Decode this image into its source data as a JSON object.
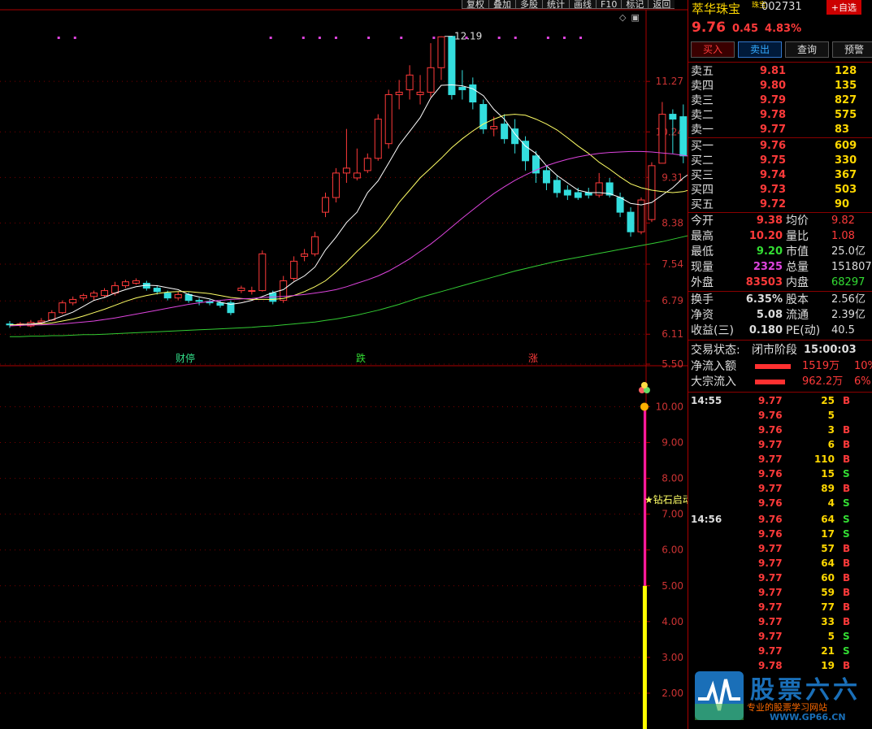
{
  "toolbar": [
    "复权",
    "叠加",
    "多股",
    "统计",
    "画线",
    "F10",
    "标记",
    "返回"
  ],
  "chart": {
    "upper_ticks": [
      "11.27",
      "10.24",
      "9.31",
      "8.38",
      "7.54",
      "6.79",
      "6.11",
      "5.50"
    ],
    "lower_ticks": [
      "10.00",
      "9.00",
      "8.00",
      "7.00",
      "6.00",
      "5.00",
      "4.00",
      "3.00",
      "2.00"
    ],
    "max_label": "12.19",
    "events": [
      "财停",
      "跌",
      "涨"
    ],
    "signal_label": "★钻石启动",
    "colors": {
      "up": "#ff3a3a",
      "down": "#33dddd",
      "ma5": "#ffffff",
      "ma10": "#ffff66",
      "ma20": "#dd44dd",
      "ma60": "#33cc33",
      "bar_top": "#ff1aa0",
      "bar_bottom": "#ffff00"
    }
  },
  "chart_data": {
    "type": "candlestick",
    "ylim": [
      5.5,
      12.6
    ],
    "candles": [
      [
        6.32,
        6.3,
        6.38,
        6.24
      ],
      [
        6.3,
        6.32,
        6.36,
        6.25
      ],
      [
        6.28,
        6.35,
        6.4,
        6.25
      ],
      [
        6.35,
        6.38,
        6.44,
        6.3
      ],
      [
        6.4,
        6.55,
        6.6,
        6.38
      ],
      [
        6.55,
        6.75,
        6.8,
        6.52
      ],
      [
        6.75,
        6.82,
        6.88,
        6.7
      ],
      [
        6.85,
        6.9,
        6.94,
        6.8
      ],
      [
        6.88,
        6.95,
        7.0,
        6.8
      ],
      [
        6.9,
        7.0,
        7.05,
        6.86
      ],
      [
        6.95,
        7.1,
        7.18,
        6.9
      ],
      [
        7.1,
        7.18,
        7.22,
        7.05
      ],
      [
        7.15,
        7.2,
        7.25,
        7.12
      ],
      [
        7.15,
        7.05,
        7.2,
        7.0
      ],
      [
        7.05,
        6.98,
        7.1,
        6.92
      ],
      [
        6.95,
        6.85,
        7.0,
        6.8
      ],
      [
        6.85,
        6.92,
        6.98,
        6.8
      ],
      [
        6.92,
        6.8,
        6.96,
        6.75
      ],
      [
        6.8,
        6.78,
        6.85,
        6.7
      ],
      [
        6.78,
        6.75,
        6.82,
        6.7
      ],
      [
        6.75,
        6.7,
        6.8,
        6.65
      ],
      [
        6.75,
        6.55,
        6.8,
        6.5
      ],
      [
        7.0,
        7.05,
        7.1,
        6.95
      ],
      [
        7.0,
        7.0,
        7.08,
        6.92
      ],
      [
        7.0,
        7.75,
        7.82,
        6.98
      ],
      [
        6.95,
        6.78,
        7.0,
        6.72
      ],
      [
        6.8,
        7.2,
        7.3,
        6.75
      ],
      [
        7.25,
        7.6,
        7.7,
        7.2
      ],
      [
        7.7,
        7.75,
        7.85,
        7.6
      ],
      [
        7.75,
        8.1,
        8.2,
        7.7
      ],
      [
        8.6,
        8.9,
        9.0,
        8.5
      ],
      [
        8.9,
        9.4,
        9.5,
        8.8
      ],
      [
        9.4,
        9.5,
        10.3,
        9.2
      ],
      [
        9.3,
        9.4,
        9.9,
        9.25
      ],
      [
        9.45,
        9.7,
        9.8,
        9.4
      ],
      [
        9.7,
        10.5,
        10.6,
        9.65
      ],
      [
        10.0,
        11.0,
        11.1,
        9.9
      ],
      [
        11.0,
        11.05,
        11.3,
        10.7
      ],
      [
        11.1,
        11.4,
        11.6,
        10.9
      ],
      [
        11.0,
        11.05,
        11.4,
        10.8
      ],
      [
        11.05,
        11.55,
        12.05,
        10.95
      ],
      [
        11.55,
        12.18,
        12.19,
        11.3
      ],
      [
        12.19,
        11.0,
        12.19,
        10.9
      ],
      [
        11.15,
        11.1,
        11.5,
        10.9
      ],
      [
        11.2,
        10.85,
        11.35,
        10.7
      ],
      [
        10.8,
        10.3,
        10.9,
        10.2
      ],
      [
        10.3,
        10.35,
        10.55,
        10.15
      ],
      [
        10.4,
        10.1,
        10.6,
        10.0
      ],
      [
        10.3,
        10.0,
        10.5,
        9.8
      ],
      [
        10.05,
        9.65,
        10.15,
        9.45
      ],
      [
        9.75,
        9.4,
        9.85,
        9.2
      ],
      [
        9.45,
        9.2,
        9.55,
        9.05
      ],
      [
        9.25,
        9.0,
        9.35,
        8.9
      ],
      [
        9.05,
        8.95,
        9.15,
        8.85
      ],
      [
        9.0,
        8.9,
        9.1,
        8.85
      ],
      [
        9.0,
        8.95,
        9.1,
        8.88
      ],
      [
        8.95,
        9.2,
        9.4,
        8.9
      ],
      [
        9.2,
        8.95,
        9.3,
        8.9
      ],
      [
        8.9,
        8.6,
        9.0,
        8.5
      ],
      [
        8.6,
        8.2,
        8.7,
        8.1
      ],
      [
        8.2,
        8.85,
        8.9,
        8.15
      ],
      [
        8.45,
        9.55,
        9.62,
        8.4
      ],
      [
        9.6,
        10.6,
        10.85,
        9.8
      ],
      [
        10.6,
        10.5,
        10.7,
        9.8
      ],
      [
        10.55,
        9.75,
        10.8,
        9.6
      ],
      [
        9.95,
        9.1,
        10.1,
        9.05
      ],
      [
        9.3,
        9.6,
        9.75,
        8.95
      ],
      [
        9.6,
        9.65,
        9.75,
        9.55
      ],
      [
        9.65,
        9.5,
        9.7,
        9.4
      ],
      [
        9.5,
        9.35,
        9.6,
        9.2
      ],
      [
        9.4,
        9.35,
        9.55,
        9.28
      ],
      [
        9.3,
        9.76,
        10.2,
        9.2
      ]
    ],
    "ma_series": [
      {
        "name": "MA5",
        "values": [
          6.3,
          6.31,
          6.32,
          6.34,
          6.4,
          6.48,
          6.56,
          6.68,
          6.8,
          6.86,
          6.95,
          7.02,
          7.08,
          7.11,
          7.1,
          7.06,
          7.02,
          6.92,
          6.87,
          6.83,
          6.76,
          6.72,
          6.75,
          6.8,
          6.88,
          6.96,
          7.02,
          7.18,
          7.3,
          7.48,
          7.83,
          8.09,
          8.39,
          8.6,
          9.0,
          9.24,
          9.6,
          9.97,
          10.25,
          10.53,
          10.93,
          11.19,
          11.2,
          11.18,
          11.12,
          10.98,
          10.7,
          10.5,
          10.2,
          9.95,
          9.8,
          9.55,
          9.35,
          9.2,
          9.05,
          9.0,
          9.0,
          8.98,
          8.9,
          8.78,
          8.75,
          8.8,
          8.95,
          9.1,
          9.3,
          9.45,
          9.5,
          9.55,
          9.55,
          9.5,
          9.48,
          9.52
        ]
      },
      {
        "name": "MA10",
        "values": [
          6.3,
          6.3,
          6.31,
          6.32,
          6.34,
          6.38,
          6.42,
          6.48,
          6.55,
          6.62,
          6.7,
          6.78,
          6.85,
          6.9,
          6.94,
          6.97,
          6.98,
          6.98,
          6.96,
          6.94,
          6.9,
          6.86,
          6.84,
          6.82,
          6.82,
          6.82,
          6.84,
          6.9,
          6.98,
          7.08,
          7.2,
          7.38,
          7.58,
          7.8,
          8.0,
          8.22,
          8.5,
          8.8,
          9.05,
          9.3,
          9.5,
          9.7,
          9.92,
          10.1,
          10.26,
          10.4,
          10.5,
          10.58,
          10.6,
          10.58,
          10.5,
          10.4,
          10.28,
          10.12,
          9.95,
          9.8,
          9.62,
          9.48,
          9.32,
          9.18,
          9.1,
          9.05,
          9.02,
          9.0,
          9.02,
          9.08,
          9.15,
          9.2,
          9.25,
          9.3,
          9.36,
          9.42
        ]
      },
      {
        "name": "MA20",
        "values": [
          6.28,
          6.29,
          6.3,
          6.3,
          6.31,
          6.32,
          6.34,
          6.36,
          6.38,
          6.41,
          6.44,
          6.48,
          6.52,
          6.56,
          6.6,
          6.64,
          6.68,
          6.72,
          6.75,
          6.78,
          6.8,
          6.82,
          6.83,
          6.84,
          6.86,
          6.87,
          6.88,
          6.9,
          6.92,
          6.95,
          6.98,
          7.02,
          7.08,
          7.15,
          7.22,
          7.3,
          7.4,
          7.52,
          7.65,
          7.8,
          7.95,
          8.12,
          8.3,
          8.48,
          8.65,
          8.82,
          8.98,
          9.12,
          9.25,
          9.36,
          9.46,
          9.55,
          9.62,
          9.68,
          9.73,
          9.77,
          9.8,
          9.82,
          9.83,
          9.84,
          9.84,
          9.83,
          9.81,
          9.79,
          9.76,
          9.73,
          9.7,
          9.67,
          9.64,
          9.61,
          9.58,
          9.55
        ]
      },
      {
        "name": "MA60",
        "values": [
          6.06,
          6.06,
          6.07,
          6.07,
          6.08,
          6.08,
          6.09,
          6.1,
          6.1,
          6.11,
          6.12,
          6.13,
          6.14,
          6.15,
          6.16,
          6.17,
          6.18,
          6.19,
          6.2,
          6.21,
          6.22,
          6.23,
          6.24,
          6.25,
          6.27,
          6.28,
          6.3,
          6.32,
          6.34,
          6.36,
          6.39,
          6.42,
          6.46,
          6.5,
          6.55,
          6.6,
          6.66,
          6.72,
          6.79,
          6.86,
          6.92,
          6.98,
          7.04,
          7.1,
          7.16,
          7.22,
          7.28,
          7.34,
          7.4,
          7.45,
          7.5,
          7.55,
          7.6,
          7.64,
          7.68,
          7.72,
          7.76,
          7.8,
          7.84,
          7.88,
          7.92,
          7.96,
          8.0,
          8.05,
          8.1,
          8.15,
          8.2,
          8.25,
          8.3,
          8.35,
          8.4,
          8.46
        ]
      }
    ],
    "lower": {
      "ylim": [
        1.0,
        11.1
      ],
      "bar_index": 61,
      "bar_top": 10.0,
      "bar_split": 5.0,
      "bar_bottom": 1.0,
      "signal_value": 7.4
    }
  },
  "quote": {
    "name": "萃华珠宝",
    "tag": "珠宝",
    "code": "002731",
    "fav": "+自选",
    "price": "9.76",
    "change": "0.45",
    "pct": "4.83%",
    "actions": [
      "买入",
      "卖出",
      "查询",
      "预警"
    ]
  },
  "orderbook": [
    {
      "label": "卖五",
      "price": "9.81",
      "vol": "128"
    },
    {
      "label": "卖四",
      "price": "9.80",
      "vol": "135"
    },
    {
      "label": "卖三",
      "price": "9.79",
      "vol": "827"
    },
    {
      "label": "卖二",
      "price": "9.78",
      "vol": "575"
    },
    {
      "label": "卖一",
      "price": "9.77",
      "vol": "83"
    },
    {
      "label": "买一",
      "price": "9.76",
      "vol": "609"
    },
    {
      "label": "买二",
      "price": "9.75",
      "vol": "330"
    },
    {
      "label": "买三",
      "price": "9.74",
      "vol": "367"
    },
    {
      "label": "买四",
      "price": "9.73",
      "vol": "503"
    },
    {
      "label": "买五",
      "price": "9.72",
      "vol": "90"
    }
  ],
  "stats": [
    {
      "l1": "今开",
      "v1": "9.38",
      "c1": "red",
      "l2": "均价",
      "v2": "9.82",
      "c2": "red"
    },
    {
      "l1": "最高",
      "v1": "10.20",
      "c1": "red",
      "l2": "量比",
      "v2": "1.08",
      "c2": "red"
    },
    {
      "l1": "最低",
      "v1": "9.20",
      "c1": "green",
      "l2": "市值",
      "v2": "25.0亿",
      "c2": "white"
    },
    {
      "l1": "现量",
      "v1": "2325",
      "c1": "magenta",
      "l2": "总量",
      "v2": "151807",
      "c2": "white"
    },
    {
      "l1": "外盘",
      "v1": "83503",
      "c1": "red",
      "l2": "内盘",
      "v2": "68297",
      "c2": "green"
    },
    {
      "l1": "换手",
      "v1": "6.35%",
      "c1": "white",
      "l2": "股本",
      "v2": "2.56亿",
      "c2": "white"
    },
    {
      "l1": "净资",
      "v1": "5.08",
      "c1": "white",
      "l2": "流通",
      "v2": "2.39亿",
      "c2": "white"
    },
    {
      "l1": "收益(三)",
      "v1": "0.180",
      "c1": "white",
      "l2": "PE(动)",
      "v2": "40.5",
      "c2": "white"
    }
  ],
  "status": {
    "label": "交易状态:",
    "value": "闭市阶段",
    "time": "15:00:03"
  },
  "flows": [
    {
      "label": "净流入额",
      "value": "1519万",
      "pct": "10%",
      "bar": 0.95
    },
    {
      "label": "大宗流入",
      "value": "962.2万",
      "pct": "6%",
      "bar": 0.8
    }
  ],
  "ticks": [
    {
      "time": "14:55",
      "price": "9.77",
      "vol": "25",
      "side": "B"
    },
    {
      "time": "",
      "price": "9.76",
      "vol": "5",
      "side": ""
    },
    {
      "time": "",
      "price": "9.76",
      "vol": "3",
      "side": "B"
    },
    {
      "time": "",
      "price": "9.77",
      "vol": "6",
      "side": "B"
    },
    {
      "time": "",
      "price": "9.77",
      "vol": "110",
      "side": "B"
    },
    {
      "time": "",
      "price": "9.76",
      "vol": "15",
      "side": "S"
    },
    {
      "time": "",
      "price": "9.77",
      "vol": "89",
      "side": "B"
    },
    {
      "time": "",
      "price": "9.76",
      "vol": "4",
      "side": "S"
    },
    {
      "time": "14:56",
      "price": "9.76",
      "vol": "64",
      "side": "S"
    },
    {
      "time": "",
      "price": "9.76",
      "vol": "17",
      "side": "S"
    },
    {
      "time": "",
      "price": "9.77",
      "vol": "57",
      "side": "B"
    },
    {
      "time": "",
      "price": "9.77",
      "vol": "64",
      "side": "B"
    },
    {
      "time": "",
      "price": "9.77",
      "vol": "60",
      "side": "B"
    },
    {
      "time": "",
      "price": "9.77",
      "vol": "59",
      "side": "B"
    },
    {
      "time": "",
      "price": "9.77",
      "vol": "77",
      "side": "B"
    },
    {
      "time": "",
      "price": "9.77",
      "vol": "33",
      "side": "B"
    },
    {
      "time": "",
      "price": "9.77",
      "vol": "5",
      "side": "S"
    },
    {
      "time": "",
      "price": "9.77",
      "vol": "21",
      "side": "S"
    },
    {
      "time": "",
      "price": "9.78",
      "vol": "19",
      "side": "B"
    }
  ],
  "watermark": {
    "title": "股票六六",
    "sub": "专业的股票学习网站",
    "url": "WWW.GP66.CN"
  }
}
